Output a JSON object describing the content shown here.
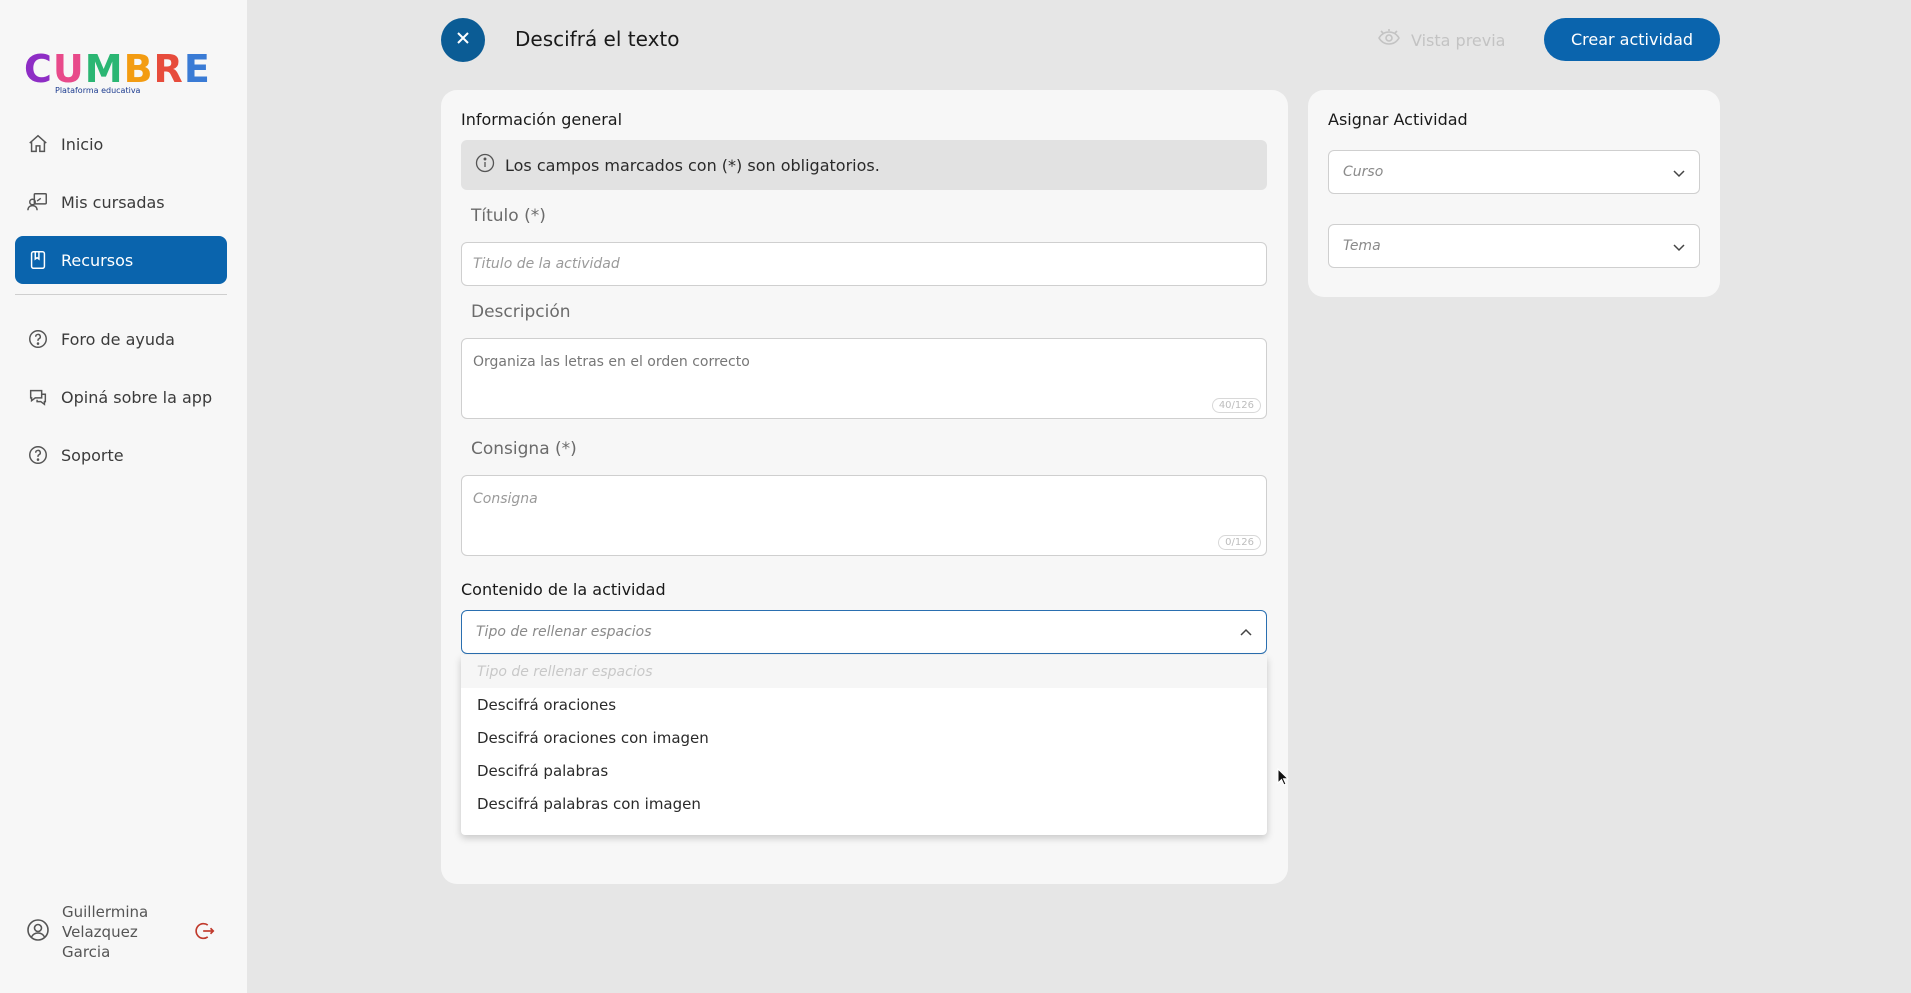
{
  "brand": {
    "name": "CUMBRE",
    "tagline": "Plataforma educativa",
    "letters": [
      {
        "ch": "C",
        "color": "#8e2dc5"
      },
      {
        "ch": "U",
        "color": "#e84a8a"
      },
      {
        "ch": "M",
        "color": "#2bb673"
      },
      {
        "ch": "B",
        "color": "#f39c12"
      },
      {
        "ch": "R",
        "color": "#e74c3c"
      },
      {
        "ch": "E",
        "color": "#3a7bd5"
      }
    ]
  },
  "sidebar": {
    "items": [
      {
        "label": "Inicio",
        "icon": "home-icon"
      },
      {
        "label": "Mis cursadas",
        "icon": "teacher-icon"
      },
      {
        "label": "Recursos",
        "icon": "book-icon",
        "active": true
      },
      {
        "label": "Foro de ayuda",
        "icon": "help-circle-icon"
      },
      {
        "label": "Opiná sobre la app",
        "icon": "chat-icon"
      },
      {
        "label": "Soporte",
        "icon": "help-circle-icon"
      }
    ],
    "user": {
      "name": "Guillermina Velazquez Garcia"
    }
  },
  "header": {
    "title": "Descifrá el texto",
    "preview_label": "Vista previa",
    "create_label": "Crear actividad"
  },
  "form": {
    "general_title": "Información general",
    "notice": "Los campos marcados con (*) son obligatorios.",
    "titulo_label": "Título (*)",
    "titulo_placeholder": "Titulo de la actividad",
    "descripcion_label": "Descripción",
    "descripcion_value": "Organiza las letras en el orden correcto",
    "descripcion_counter": "40/126",
    "consigna_label": "Consigna (*)",
    "consigna_placeholder": "Consigna",
    "consigna_counter": "0/126",
    "content_title": "Contenido de la actividad",
    "content_select_placeholder": "Tipo de rellenar espacios",
    "dropdown_options": [
      "Tipo de rellenar espacios",
      "Descifrá oraciones",
      "Descifrá oraciones con imagen",
      "Descifrá palabras",
      "Descifrá palabras con imagen"
    ]
  },
  "assign": {
    "title": "Asignar Actividad",
    "curso_placeholder": "Curso",
    "tema_placeholder": "Tema"
  },
  "colors": {
    "primary": "#0a64ad",
    "logout": "#c0392b"
  }
}
